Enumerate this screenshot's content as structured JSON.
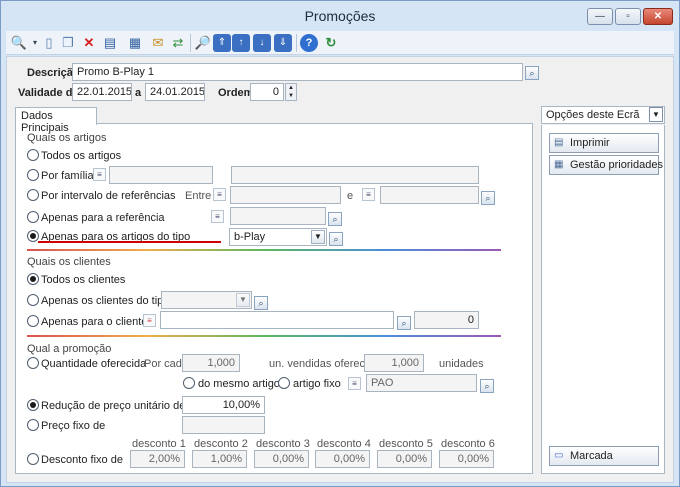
{
  "window": {
    "title": "Promoções",
    "minimize": "—",
    "maximize": "▫",
    "close": "✕"
  },
  "toolbar": {
    "icons": [
      "search-icon",
      "new-document-icon",
      "copy-icon",
      "delete-icon",
      "properties-icon",
      "grid-icon",
      "email-icon",
      "refresh-icon",
      "preview-icon",
      "first-record-icon",
      "previous-record-icon",
      "next-record-icon",
      "last-record-icon",
      "help-icon",
      "sync-icon"
    ]
  },
  "header": {
    "descricao_label": "Descrição",
    "descricao_value": "Promo B-Play 1",
    "validade_label": "Validade de",
    "validade_from": "22.01.2015",
    "validade_a": "a",
    "validade_to": "24.01.2015",
    "ordem_label": "Ordem",
    "ordem_value": "0"
  },
  "tab": {
    "label": "Dados Principais"
  },
  "artigos": {
    "section": "Quais os artigos",
    "todos": "Todos os artigos",
    "familia": "Por família",
    "intervalo": "Por intervalo de referências",
    "entre": "Entre",
    "e": "e",
    "referencia": "Apenas para a referência",
    "tipo": "Apenas para os artigos do tipo",
    "tipo_value": "b-Play"
  },
  "clientes": {
    "section": "Quais os clientes",
    "todos": "Todos os clientes",
    "tipo": "Apenas os clientes do tipo",
    "cliente": "Apenas para o cliente",
    "cliente_num": "0"
  },
  "promocao": {
    "section": "Qual a promoção",
    "quantidade": "Quantidade oferecida",
    "por_cada": "Por cada",
    "por_cada_value": "1,000",
    "un_vendidas": "un. vendidas oferece",
    "oferece_value": "1,000",
    "unidades": "unidades",
    "mesmo_artigo": "do mesmo artigo",
    "artigo_fixo": "artigo fixo",
    "artigo_fixo_value": "PAO",
    "reducao": "Redução de preço unitário de",
    "reducao_value": "10,00%",
    "preco_fixo": "Preço fixo de",
    "desconto_fixo": "Desconto fixo de",
    "descontos": [
      {
        "label": "desconto 1",
        "value": "2,00%"
      },
      {
        "label": "desconto 2",
        "value": "1,00%"
      },
      {
        "label": "desconto 3",
        "value": "0,00%"
      },
      {
        "label": "desconto 4",
        "value": "0,00%"
      },
      {
        "label": "desconto 5",
        "value": "0,00%"
      },
      {
        "label": "desconto 6",
        "value": "0,00%"
      }
    ]
  },
  "side": {
    "title": "Opções deste Ecrã",
    "imprimir": "Imprimir",
    "gestao": "Gestão prioridades",
    "marcada": "Marcada"
  }
}
